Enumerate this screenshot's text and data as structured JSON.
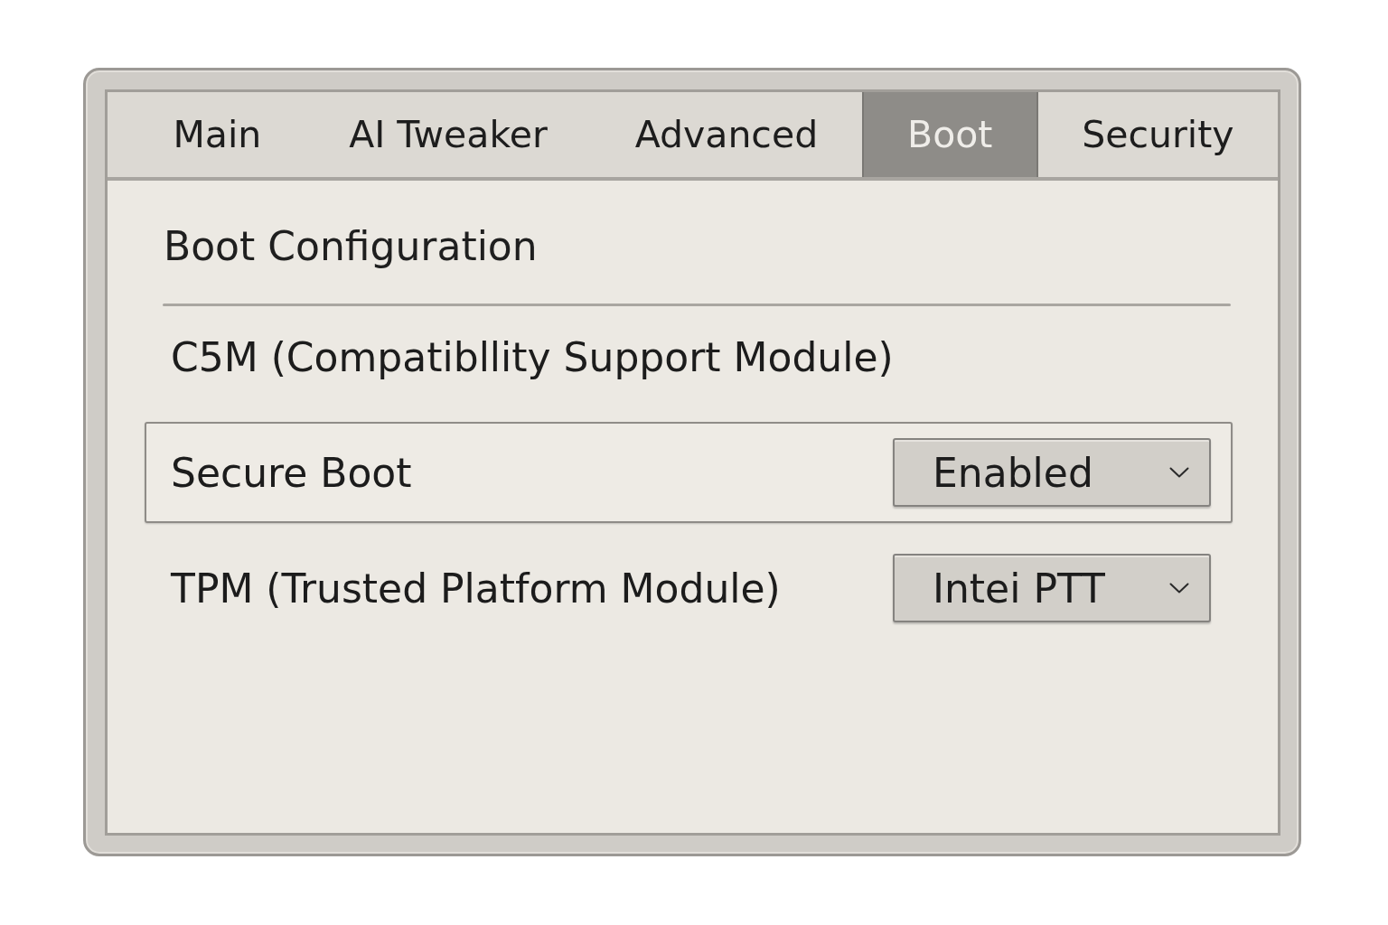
{
  "tabs": [
    {
      "label": "Main",
      "selected": false
    },
    {
      "label": "AI Tweaker",
      "selected": false
    },
    {
      "label": "Advanced",
      "selected": false
    },
    {
      "label": "Boot",
      "selected": true
    },
    {
      "label": "Security",
      "selected": false
    }
  ],
  "section": {
    "title": "Boot Configuration"
  },
  "settings": [
    {
      "kind": "text",
      "label": "C5M (Compatibllity Support Module)",
      "selected": false
    },
    {
      "kind": "dropdown",
      "label": "Secure Boot",
      "value": "Enabled",
      "selected": true
    },
    {
      "kind": "dropdown",
      "label": "TPM (Trusted Platform Module)",
      "value": "Intei PTT",
      "selected": false
    }
  ]
}
